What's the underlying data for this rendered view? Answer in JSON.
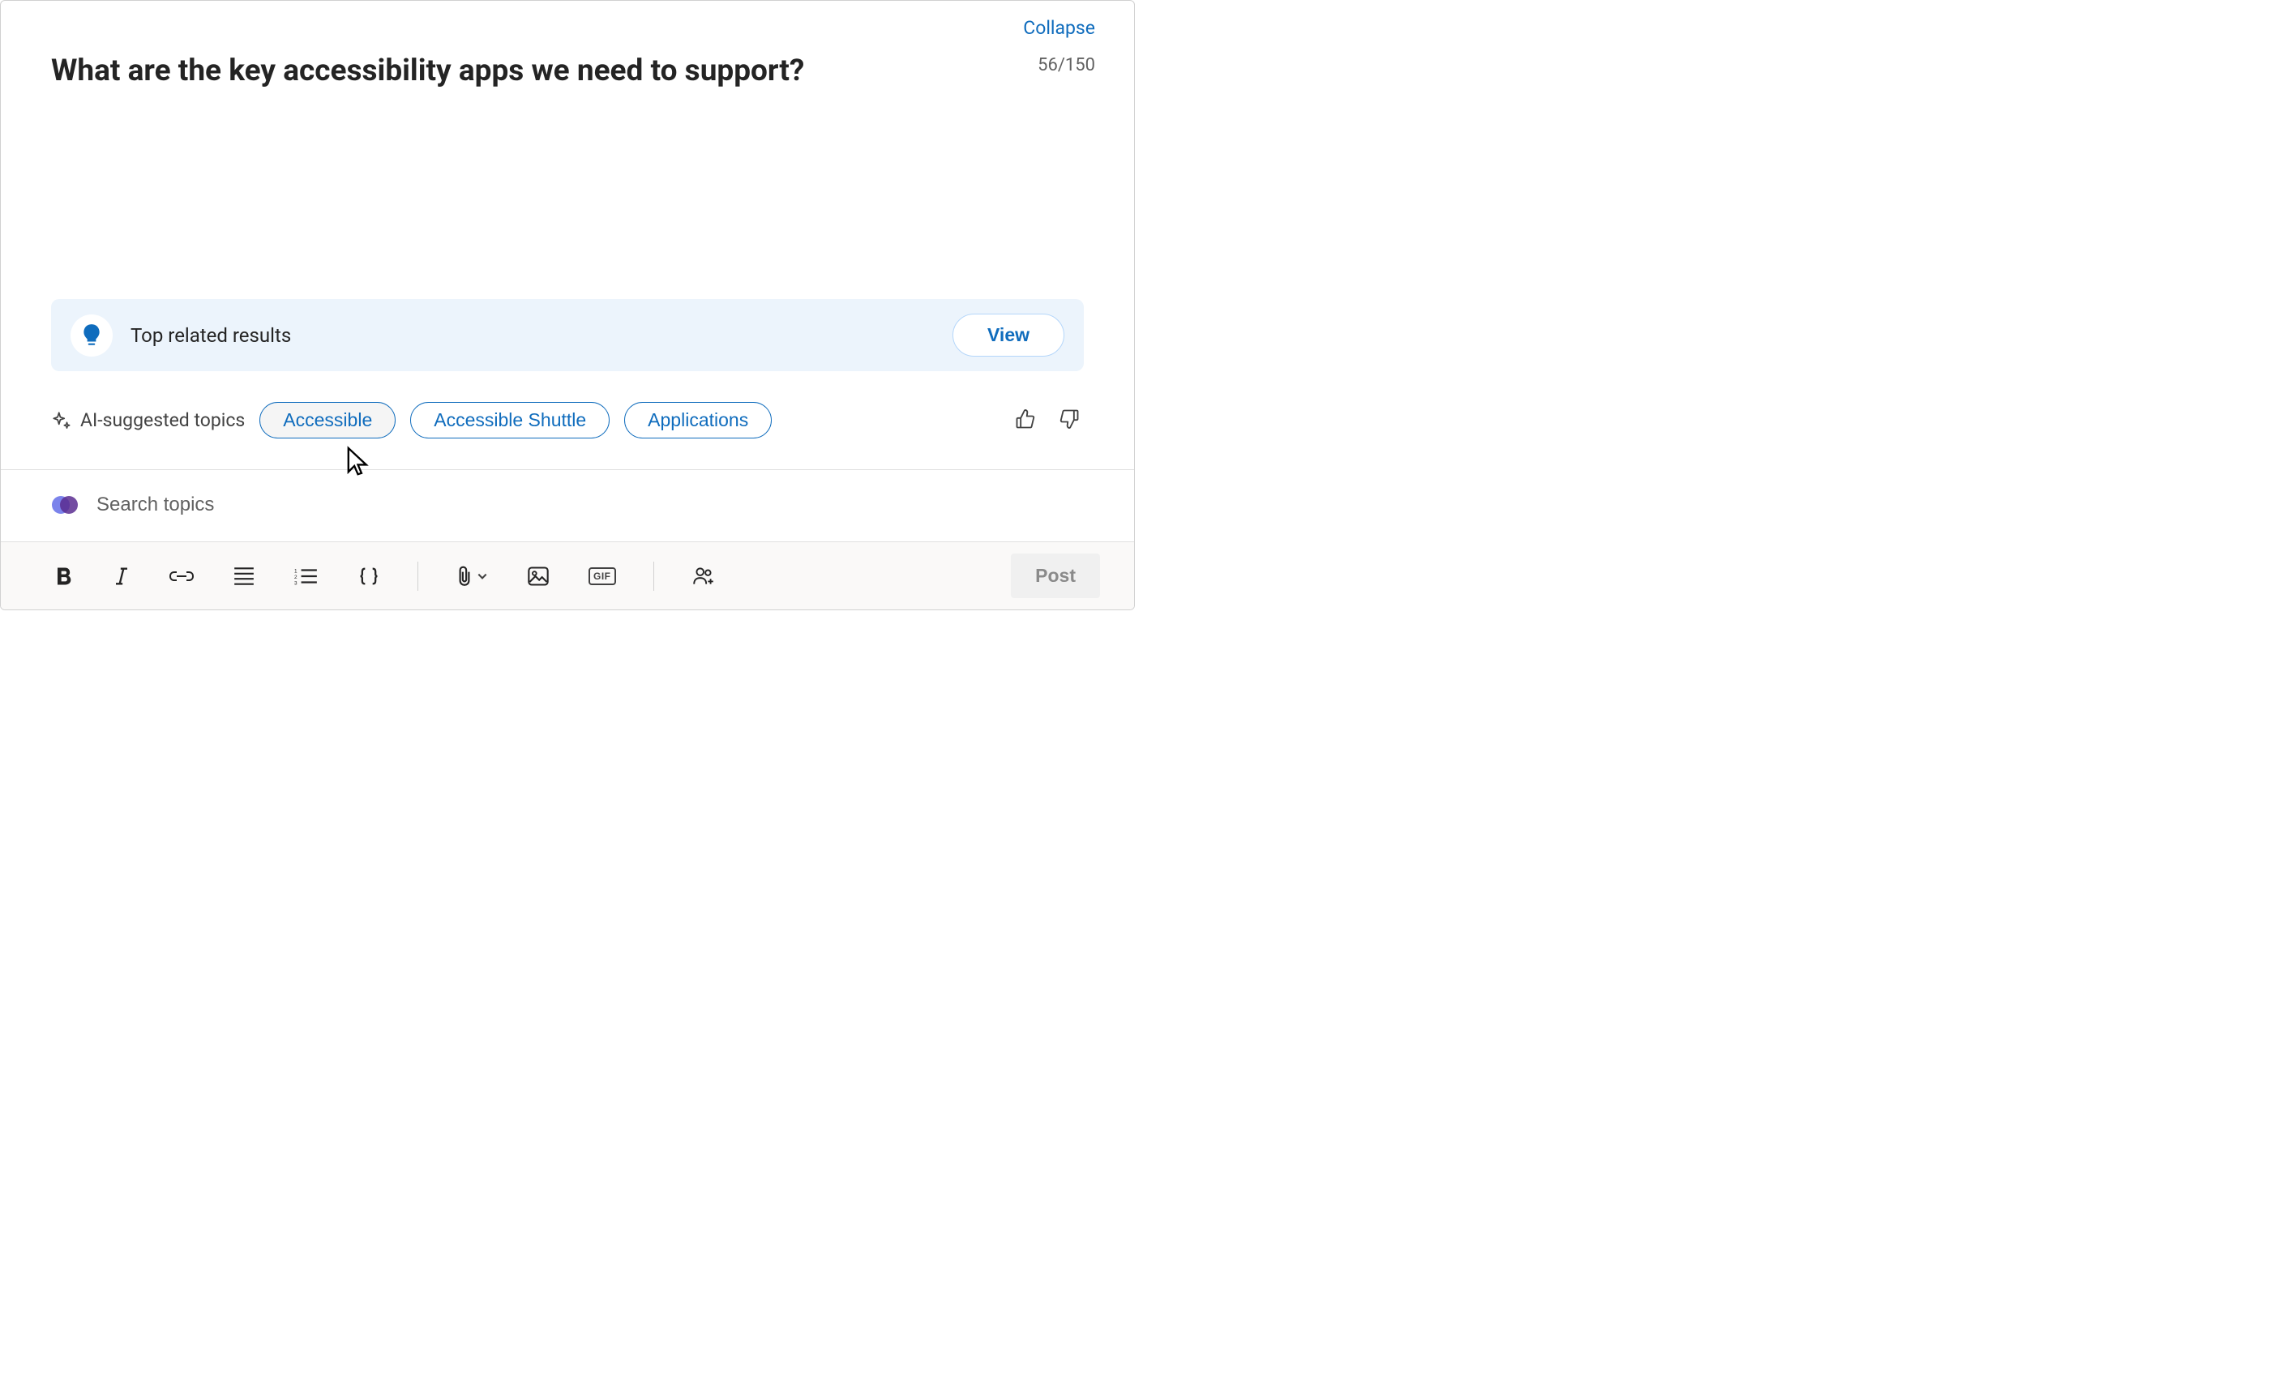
{
  "header": {
    "collapse_label": "Collapse",
    "title": "What are the key accessibility apps we need to support?",
    "counter": "56/150"
  },
  "related": {
    "label": "Top related results",
    "view_label": "View"
  },
  "ai_topics": {
    "label": "AI-suggested topics",
    "chips": [
      "Accessible",
      "Accessible Shuttle",
      "Applications"
    ]
  },
  "search": {
    "placeholder": "Search topics"
  },
  "toolbar": {
    "post_label": "Post",
    "gif_label": "GIF"
  }
}
